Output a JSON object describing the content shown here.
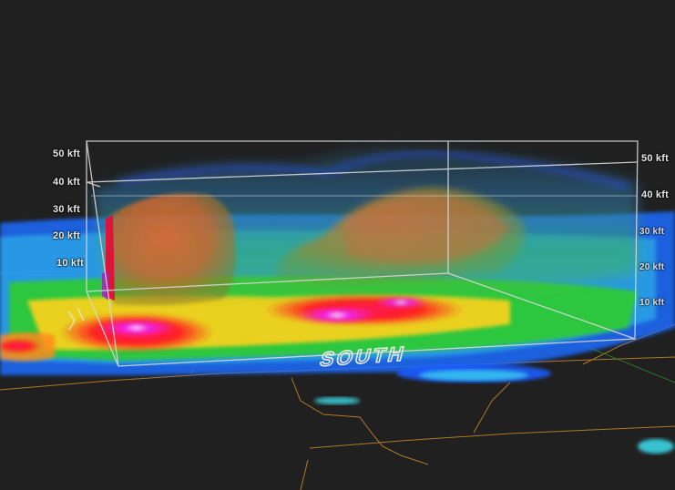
{
  "altitude_scale": {
    "unit": "kft",
    "left_labels": [
      "50 kft",
      "40 kft",
      "30 kft",
      "20 kft",
      "10 kft"
    ],
    "right_labels": [
      "50 kft",
      "40 kft",
      "30 kft",
      "20 kft",
      "10 kft"
    ]
  },
  "compass": {
    "face_label": "SOUTH"
  },
  "colors": {
    "background": "#202020",
    "box_outline": "#d8d8d8",
    "county_lines": "#c98a2a",
    "reflectivity_low": "#1e6cff",
    "reflectivity_mid": "#2ecc2e",
    "reflectivity_high": "#ffd21e",
    "reflectivity_very_high": "#ff1e1e",
    "reflectivity_extreme": "#e21ee2",
    "isosurface": "#e0782a"
  }
}
